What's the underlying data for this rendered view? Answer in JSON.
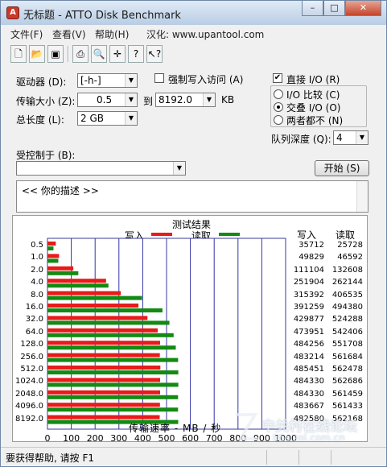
{
  "window": {
    "title": "无标题 - ATTO Disk Benchmark",
    "controls": {
      "minimize": "–",
      "maximize": "□",
      "close": "✕"
    }
  },
  "menu": {
    "file": "文件(F)",
    "view": "查看(V)",
    "help": "帮助(H)",
    "localize": "汉化: www.upantool.com"
  },
  "toolbar": {
    "icons": [
      "new-file-icon",
      "open-folder-icon",
      "save-icon",
      "print-icon",
      "print-preview-icon",
      "move-icon",
      "help-icon",
      "context-help-icon"
    ]
  },
  "settings": {
    "drive_label": "驱动器 (D):",
    "drive_value": "[-h-]",
    "force_write_label": "强制写入访问 (A)",
    "force_write_checked": false,
    "transfer_label": "传输大小 (Z):",
    "transfer_from": "0.5",
    "to_label": "到",
    "transfer_to": "8192.0",
    "kb_label": "KB",
    "total_label": "总长度 (L):",
    "total_value": "2 GB",
    "direct_io_label": "直接 I/O (R)",
    "direct_io_checked": true,
    "radio_io_compare": "I/O 比较 (C)",
    "radio_overlap": "交叠 I/O (O)",
    "radio_none": "两者都不 (N)",
    "selected_radio": "overlap",
    "queue_label": "队列深度 (Q):",
    "queue_value": "4",
    "controlled_by_label": "受控制于 (B):",
    "controlled_by_value": "",
    "start_button": "开始 (S)",
    "description": "<<   你的描述    >>"
  },
  "results": {
    "title": "测试结果",
    "write_legend": "写入",
    "read_legend": "读取",
    "write_col": "写入",
    "read_col": "读取",
    "write_color": "#e81a1a",
    "read_color": "#138a13",
    "x_axis_label": "传输速率 - MB / 秒",
    "x_ticks": [
      "0",
      "100",
      "200",
      "300",
      "400",
      "500",
      "600",
      "700",
      "800",
      "900",
      "1000"
    ]
  },
  "chart_data": {
    "type": "bar",
    "orientation": "horizontal",
    "title": "测试结果",
    "xlabel": "传输速率 - MB / 秒",
    "ylabel": "",
    "xlim": [
      0,
      1000
    ],
    "grid": true,
    "legend": "top",
    "categories": [
      "0.5",
      "1.0",
      "2.0",
      "4.0",
      "8.0",
      "16.0",
      "32.0",
      "64.0",
      "128.0",
      "256.0",
      "512.0",
      "1024.0",
      "2048.0",
      "4096.0",
      "8192.0"
    ],
    "series": [
      {
        "name": "写入",
        "values": [
          35712,
          49829,
          111104,
          251904,
          315392,
          391259,
          429877,
          473951,
          484256,
          483214,
          485451,
          484330,
          484330,
          483667,
          482580
        ]
      },
      {
        "name": "读取",
        "values": [
          25728,
          46592,
          132608,
          262144,
          406535,
          494380,
          524288,
          542406,
          551708,
          561684,
          562478,
          562686,
          561459,
          561433,
          562168
        ]
      }
    ]
  },
  "status": {
    "text": "要获得帮助, 请按 F1"
  },
  "watermark": {
    "text": "中关村在线论坛",
    "url": "bbs.zol.com.cn"
  }
}
